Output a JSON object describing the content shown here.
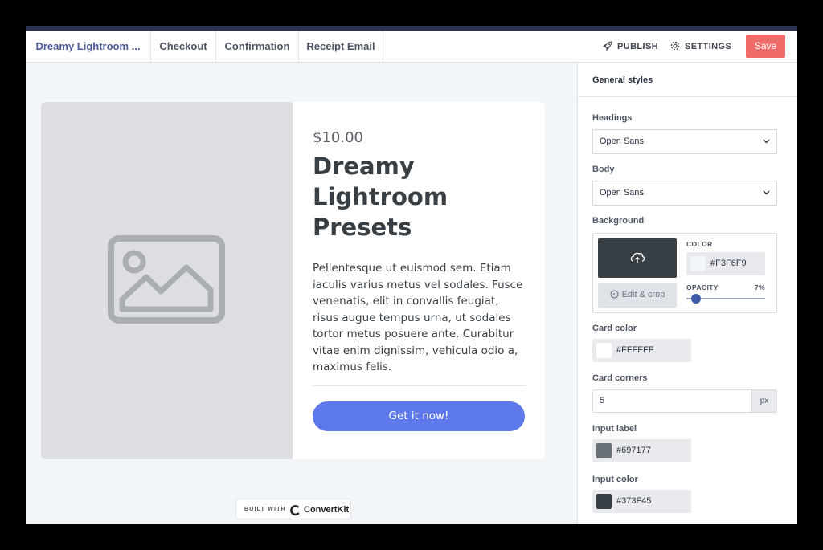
{
  "tabs": [
    {
      "label": "Dreamy Lightroom ..."
    },
    {
      "label": "Checkout"
    },
    {
      "label": "Confirmation"
    },
    {
      "label": "Receipt Email"
    }
  ],
  "actions": {
    "publish": "PUBLISH",
    "settings": "SETTINGS",
    "save": "Save"
  },
  "product": {
    "price": "$10.00",
    "title_lines": [
      "Dreamy",
      "Lightroom",
      "Presets"
    ],
    "description": "Pellentesque ut euismod sem. Etiam iaculis varius metus vel sodales. Fusce venenatis, elit in convallis feugiat, risus augue tempus urna, ut sodales tortor metus posuere ante. Curabitur vitae enim dignissim, vehicula odio a, maximus felis.",
    "cta": "Get it now!"
  },
  "built_with": {
    "label": "BUILT WITH",
    "brand": "ConvertKit"
  },
  "panel": {
    "title": "General styles",
    "headings_label": "Headings",
    "headings_value": "Open Sans",
    "body_label": "Body",
    "body_value": "Open Sans",
    "background_label": "Background",
    "bg_color_label": "COLOR",
    "bg_color_value": "#F3F6F9",
    "edit_crop": "Edit & crop",
    "opacity_label": "OPACITY",
    "opacity_value": "7%",
    "opacity_fraction": 0.07,
    "card_color_label": "Card color",
    "card_color_value": "#FFFFFF",
    "card_corners_label": "Card corners",
    "card_corners_value": "5",
    "card_corners_unit": "px",
    "input_label_label": "Input label",
    "input_label_value": "#697177",
    "input_color_label": "Input color",
    "input_color_value": "#373F45"
  },
  "colors": {
    "accent": "#5d78ea",
    "save": "#f26b6b",
    "topbar_stripe": "#2b3150"
  },
  "icons": [
    "rocket-icon",
    "gear-icon",
    "image-placeholder-icon",
    "chevron-down-icon",
    "upload-cloud-icon",
    "crop-icon",
    "convertkit-logo-icon"
  ]
}
